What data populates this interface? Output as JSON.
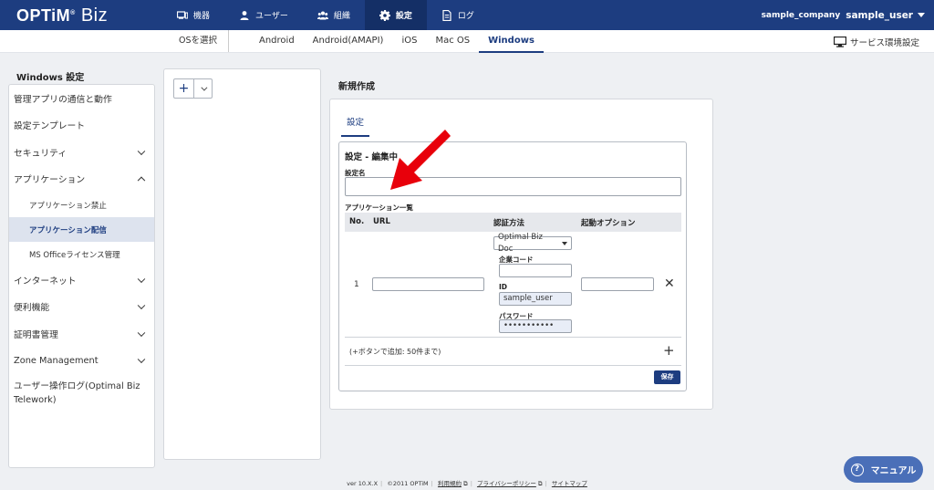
{
  "header": {
    "logo": "OPTiM",
    "logo_suffix": "Biz",
    "nav": [
      {
        "label": "機器",
        "icon": "device-icon"
      },
      {
        "label": "ユーザー",
        "icon": "user-icon"
      },
      {
        "label": "組織",
        "icon": "group-icon"
      },
      {
        "label": "設定",
        "icon": "gear-icon"
      },
      {
        "label": "ログ",
        "icon": "document-icon"
      }
    ],
    "company": "sample_company",
    "user": "sample_user"
  },
  "osbar": {
    "select_label": "OSを選択",
    "tabs": [
      "Android",
      "Android(AMAPI)",
      "iOS",
      "Mac OS",
      "Windows"
    ],
    "active_tab": "Windows",
    "service_settings": "サービス環境設定"
  },
  "sidebar": {
    "title": "Windows 設定",
    "items": [
      {
        "label": "管理アプリの通信と動作"
      },
      {
        "label": "設定テンプレート"
      },
      {
        "label": "セキュリティ"
      },
      {
        "label": "アプリケーション"
      },
      {
        "label": "アプリケーション禁止"
      },
      {
        "label": "アプリケーション配信"
      },
      {
        "label": "MS Officeライセンス管理"
      },
      {
        "label": "インターネット"
      },
      {
        "label": "便利機能"
      },
      {
        "label": "証明書管理"
      },
      {
        "label": "Zone Management"
      },
      {
        "label": "ユーザー操作ログ(Optimal Biz Telework)"
      }
    ]
  },
  "list": {
    "add_symbol": "+"
  },
  "main": {
    "title": "新規作成",
    "tab": "設定",
    "edit_heading": "設定 - 編集中",
    "name_label": "設定名",
    "name_value": "",
    "app_list_label": "アプリケーション一覧",
    "columns": [
      "No.",
      "URL",
      "認証方法",
      "起動オプション"
    ],
    "row": {
      "no": "1",
      "url": "",
      "auth_method": "Optimal Biz Doc",
      "company_code_label": "企業コード",
      "company_code": "",
      "id_label": "ID",
      "id_value": "sample_user",
      "password_label": "パスワード",
      "password_value": "•••••••••••",
      "launch_option": "",
      "remove_symbol": "✕"
    },
    "add_hint": "(+ボタンで追加: 50件まで)",
    "add_symbol": "+",
    "save_label": "保存"
  },
  "footer": {
    "version": "ver 10.X.X",
    "copyright": "©2011 OPTiM",
    "terms": "利用規約",
    "privacy": "プライバシーポリシー",
    "sitemap": "サイトマップ"
  },
  "manual": {
    "label": "マニュアル",
    "icon_glyph": "?"
  },
  "colors": {
    "brand": "#1d3d80",
    "accent_arrow": "#e8000b",
    "manual_button": "#4a6fb8"
  }
}
